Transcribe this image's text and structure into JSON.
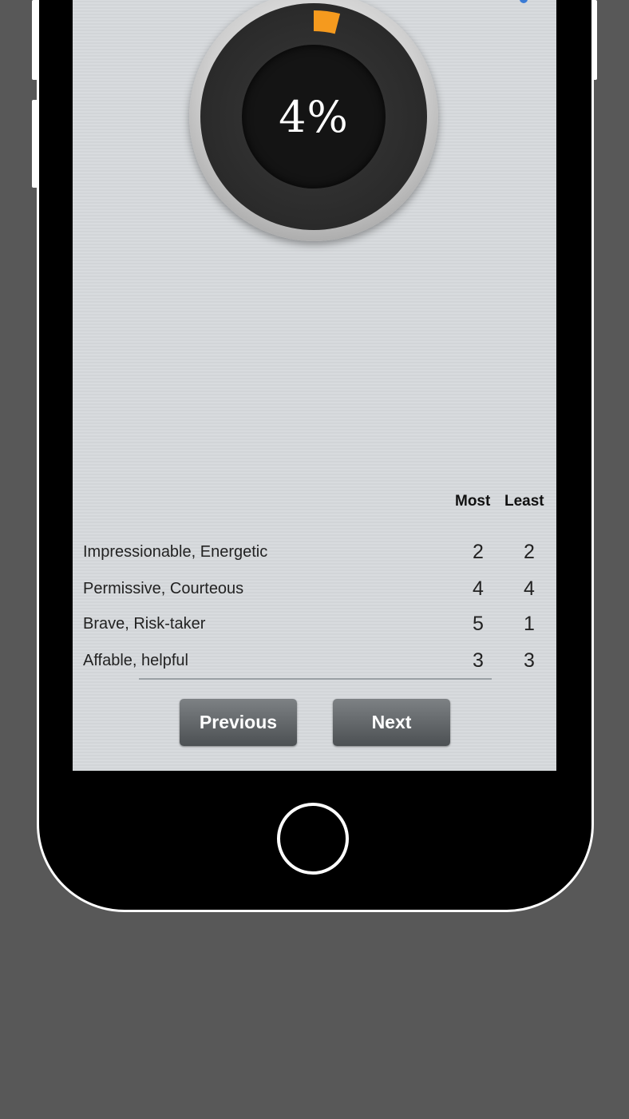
{
  "gauge": {
    "percent_text": "4%",
    "progress": 0.04,
    "accent_color": "#f59a1e"
  },
  "table": {
    "headers": {
      "most": "Most",
      "least": "Least"
    },
    "rows": [
      {
        "label": "Impressionable, Energetic",
        "most": "2",
        "least": "2"
      },
      {
        "label": "Permissive, Courteous",
        "most": "4",
        "least": "4"
      },
      {
        "label": "Brave, Risk-taker",
        "most": "5",
        "least": "1"
      },
      {
        "label": "Affable, helpful",
        "most": "3",
        "least": "3"
      }
    ]
  },
  "buttons": {
    "previous": "Previous",
    "next": "Next"
  }
}
